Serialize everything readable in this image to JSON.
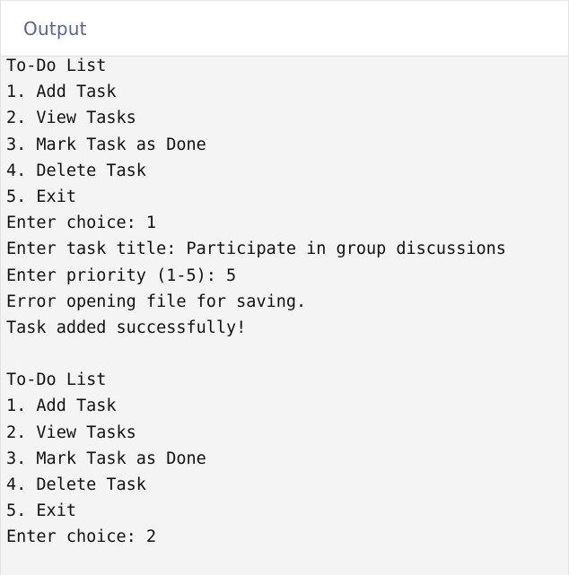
{
  "header": {
    "title": "Output"
  },
  "console": {
    "lines": [
      "To-Do List",
      "1. Add Task",
      "2. View Tasks",
      "3. Mark Task as Done",
      "4. Delete Task",
      "5. Exit",
      "Enter choice: 1",
      "Enter task title: Participate in group discussions",
      "Enter priority (1-5): 5",
      "Error opening file for saving.",
      "Task added successfully!",
      "",
      "To-Do List",
      "1. Add Task",
      "2. View Tasks",
      "3. Mark Task as Done",
      "4. Delete Task",
      "5. Exit",
      "Enter choice: 2"
    ]
  }
}
